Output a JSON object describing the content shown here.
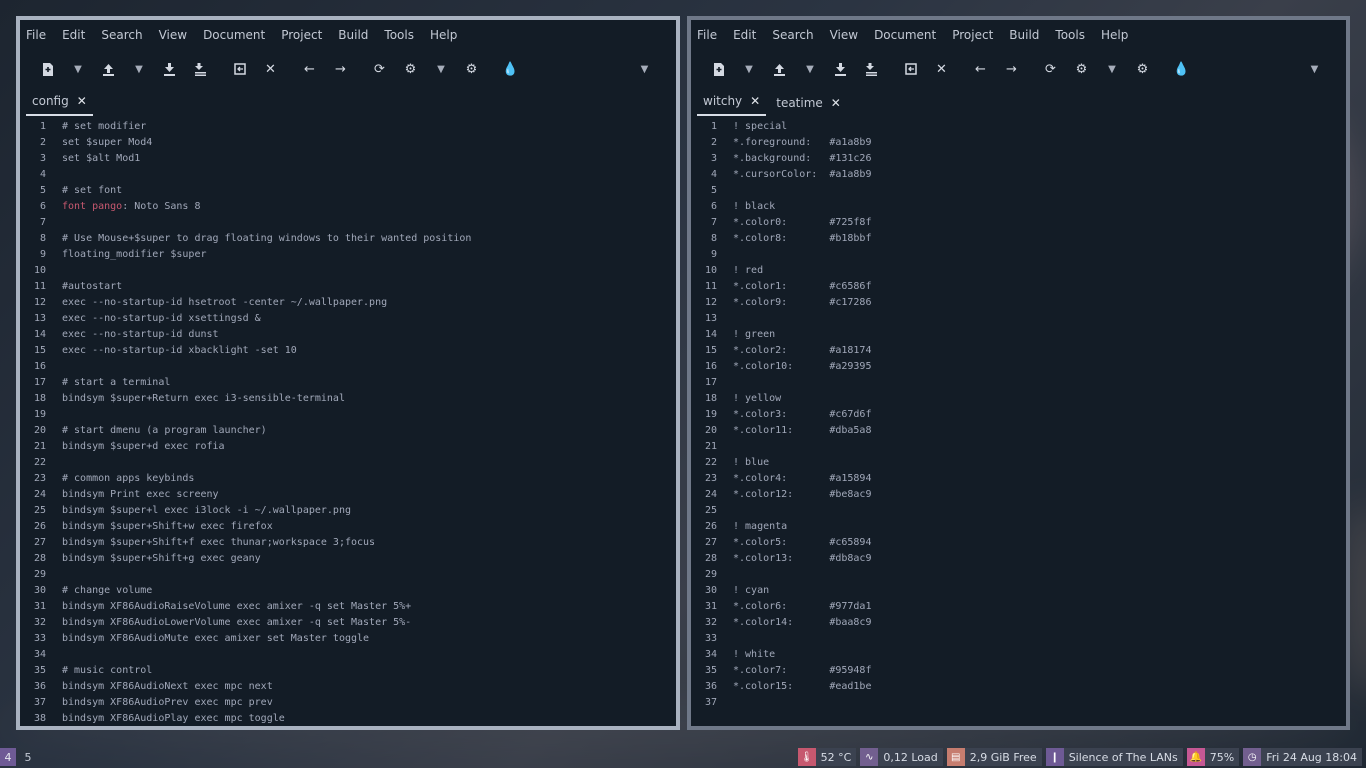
{
  "left_window": {
    "menu": [
      "File",
      "Edit",
      "Search",
      "View",
      "Document",
      "Project",
      "Build",
      "Tools",
      "Help"
    ],
    "tabs": [
      {
        "label": "config"
      }
    ],
    "lines": [
      {
        "n": "1",
        "kw": "",
        "text": "# set modifier"
      },
      {
        "n": "2",
        "kw": "",
        "text": "set $super Mod4"
      },
      {
        "n": "3",
        "kw": "",
        "text": "set $alt Mod1"
      },
      {
        "n": "4",
        "kw": "",
        "text": ""
      },
      {
        "n": "5",
        "kw": "",
        "text": "# set font"
      },
      {
        "n": "6",
        "kw": "font pango",
        "text": ": Noto Sans 8"
      },
      {
        "n": "7",
        "kw": "",
        "text": ""
      },
      {
        "n": "8",
        "kw": "",
        "text": "# Use Mouse+$super to drag floating windows to their wanted position"
      },
      {
        "n": "9",
        "kw": "",
        "text": "floating_modifier $super"
      },
      {
        "n": "10",
        "kw": "",
        "text": ""
      },
      {
        "n": "11",
        "kw": "",
        "text": "#autostart"
      },
      {
        "n": "12",
        "kw": "",
        "text": "exec --no-startup-id hsetroot -center ~/.wallpaper.png"
      },
      {
        "n": "13",
        "kw": "",
        "text": "exec --no-startup-id xsettingsd &"
      },
      {
        "n": "14",
        "kw": "",
        "text": "exec --no-startup-id dunst"
      },
      {
        "n": "15",
        "kw": "",
        "text": "exec --no-startup-id xbacklight -set 10"
      },
      {
        "n": "16",
        "kw": "",
        "text": ""
      },
      {
        "n": "17",
        "kw": "",
        "text": "# start a terminal"
      },
      {
        "n": "18",
        "kw": "",
        "text": "bindsym $super+Return exec i3-sensible-terminal"
      },
      {
        "n": "19",
        "kw": "",
        "text": ""
      },
      {
        "n": "20",
        "kw": "",
        "text": "# start dmenu (a program launcher)"
      },
      {
        "n": "21",
        "kw": "",
        "text": "bindsym $super+d exec rofia"
      },
      {
        "n": "22",
        "kw": "",
        "text": ""
      },
      {
        "n": "23",
        "kw": "",
        "text": "# common apps keybinds"
      },
      {
        "n": "24",
        "kw": "",
        "text": "bindsym Print exec screeny"
      },
      {
        "n": "25",
        "kw": "",
        "text": "bindsym $super+l exec i3lock -i ~/.wallpaper.png"
      },
      {
        "n": "26",
        "kw": "",
        "text": "bindsym $super+Shift+w exec firefox"
      },
      {
        "n": "27",
        "kw": "",
        "text": "bindsym $super+Shift+f exec thunar;workspace 3;focus"
      },
      {
        "n": "28",
        "kw": "",
        "text": "bindsym $super+Shift+g exec geany"
      },
      {
        "n": "29",
        "kw": "",
        "text": ""
      },
      {
        "n": "30",
        "kw": "",
        "text": "# change volume"
      },
      {
        "n": "31",
        "kw": "",
        "text": "bindsym XF86AudioRaiseVolume exec amixer -q set Master 5%+"
      },
      {
        "n": "32",
        "kw": "",
        "text": "bindsym XF86AudioLowerVolume exec amixer -q set Master 5%-"
      },
      {
        "n": "33",
        "kw": "",
        "text": "bindsym XF86AudioMute exec amixer set Master toggle"
      },
      {
        "n": "34",
        "kw": "",
        "text": ""
      },
      {
        "n": "35",
        "kw": "",
        "text": "# music control"
      },
      {
        "n": "36",
        "kw": "",
        "text": "bindsym XF86AudioNext exec mpc next"
      },
      {
        "n": "37",
        "kw": "",
        "text": "bindsym XF86AudioPrev exec mpc prev"
      },
      {
        "n": "38",
        "kw": "",
        "text": "bindsym XF86AudioPlay exec mpc toggle"
      }
    ]
  },
  "right_window": {
    "menu": [
      "File",
      "Edit",
      "Search",
      "View",
      "Document",
      "Project",
      "Build",
      "Tools",
      "Help"
    ],
    "tabs": [
      {
        "label": "witchy"
      },
      {
        "label": "teatime"
      }
    ],
    "lines": [
      {
        "n": "1",
        "kw": "",
        "text": "! special"
      },
      {
        "n": "2",
        "kw": "",
        "text": "*.foreground:   #a1a8b9"
      },
      {
        "n": "3",
        "kw": "",
        "text": "*.background:   #131c26"
      },
      {
        "n": "4",
        "kw": "",
        "text": "*.cursorColor:  #a1a8b9"
      },
      {
        "n": "5",
        "kw": "",
        "text": ""
      },
      {
        "n": "6",
        "kw": "",
        "text": "! black"
      },
      {
        "n": "7",
        "kw": "",
        "text": "*.color0:       #725f8f"
      },
      {
        "n": "8",
        "kw": "",
        "text": "*.color8:       #b18bbf"
      },
      {
        "n": "9",
        "kw": "",
        "text": ""
      },
      {
        "n": "10",
        "kw": "",
        "text": "! red"
      },
      {
        "n": "11",
        "kw": "",
        "text": "*.color1:       #c6586f"
      },
      {
        "n": "12",
        "kw": "",
        "text": "*.color9:       #c17286"
      },
      {
        "n": "13",
        "kw": "",
        "text": ""
      },
      {
        "n": "14",
        "kw": "",
        "text": "! green"
      },
      {
        "n": "15",
        "kw": "",
        "text": "*.color2:       #a18174"
      },
      {
        "n": "16",
        "kw": "",
        "text": "*.color10:      #a29395"
      },
      {
        "n": "17",
        "kw": "",
        "text": ""
      },
      {
        "n": "18",
        "kw": "",
        "text": "! yellow"
      },
      {
        "n": "19",
        "kw": "",
        "text": "*.color3:       #c67d6f"
      },
      {
        "n": "20",
        "kw": "",
        "text": "*.color11:      #dba5a8"
      },
      {
        "n": "21",
        "kw": "",
        "text": ""
      },
      {
        "n": "22",
        "kw": "",
        "text": "! blue"
      },
      {
        "n": "23",
        "kw": "",
        "text": "*.color4:       #a15894"
      },
      {
        "n": "24",
        "kw": "",
        "text": "*.color12:      #be8ac9"
      },
      {
        "n": "25",
        "kw": "",
        "text": ""
      },
      {
        "n": "26",
        "kw": "",
        "text": "! magenta"
      },
      {
        "n": "27",
        "kw": "",
        "text": "*.color5:       #c65894"
      },
      {
        "n": "28",
        "kw": "",
        "text": "*.color13:      #db8ac9"
      },
      {
        "n": "29",
        "kw": "",
        "text": ""
      },
      {
        "n": "30",
        "kw": "",
        "text": "! cyan"
      },
      {
        "n": "31",
        "kw": "",
        "text": "*.color6:       #977da1"
      },
      {
        "n": "32",
        "kw": "",
        "text": "*.color14:      #baa8c9"
      },
      {
        "n": "33",
        "kw": "",
        "text": ""
      },
      {
        "n": "34",
        "kw": "",
        "text": "! white"
      },
      {
        "n": "35",
        "kw": "",
        "text": "*.color7:       #95948f"
      },
      {
        "n": "36",
        "kw": "",
        "text": "*.color15:      #ead1be"
      },
      {
        "n": "37",
        "kw": "",
        "text": ""
      }
    ]
  },
  "toolbar_icons": [
    "new-file",
    "dropdown",
    "open-file",
    "dropdown",
    "save",
    "save-all",
    "revert",
    "close",
    "back",
    "forward",
    "reload",
    "compile",
    "dropdown",
    "build",
    "color-chooser",
    "collapse"
  ],
  "statusbar": {
    "workspaces": [
      {
        "label": "4",
        "active": true
      },
      {
        "label": "5",
        "active": false
      }
    ],
    "blocks": [
      {
        "icon": "thermometer-icon",
        "text": "52 °C",
        "color": "#c6586f"
      },
      {
        "icon": "load-icon",
        "text": "0,12 Load",
        "color": "#725f8f"
      },
      {
        "icon": "memory-icon",
        "text": "2,9 GiB Free",
        "color": "#c67d6f"
      },
      {
        "icon": "wifi-icon",
        "text": "Silence of The LANs",
        "color": "#6e5a95"
      },
      {
        "icon": "bell-icon",
        "text": "75%",
        "color": "#c65894"
      },
      {
        "icon": "clock-icon",
        "text": "Fri 24 Aug 18:04",
        "color": "#725f8f"
      }
    ]
  }
}
